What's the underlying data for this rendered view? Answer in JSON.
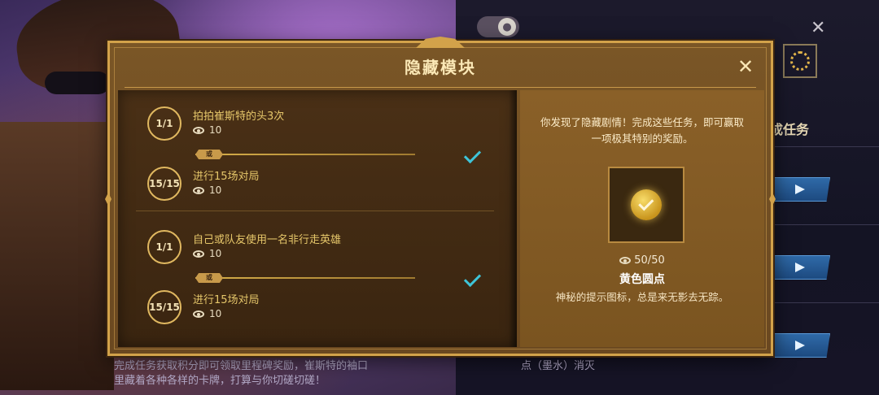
{
  "background": {
    "right_tab_label": "成任务",
    "left_note": "完成任务获取积分即可领取里程碑奖励，崔斯特的袖口里藏着各种各样的卡牌，打算与你切磋切磋！",
    "right_note": "点（墨水）消灭"
  },
  "modal": {
    "title": "隐藏模块",
    "close_icon": "close-icon",
    "groups": [
      {
        "tasks": [
          {
            "progress": "1/1",
            "name": "拍拍崔斯特的头3次",
            "views": "10"
          },
          {
            "progress": "15/15",
            "name": "进行15场对局",
            "views": "10"
          }
        ],
        "connector_label": "或",
        "completed": true
      },
      {
        "tasks": [
          {
            "progress": "1/1",
            "name": "自己或队友使用一名非行走英雄",
            "views": "10"
          },
          {
            "progress": "15/15",
            "name": "进行15场对局",
            "views": "10"
          }
        ],
        "connector_label": "或",
        "completed": true
      }
    ],
    "reward": {
      "description": "你发现了隐藏剧情！完成这些任务，即可赢取一项极其特别的奖励。",
      "count": "50/50",
      "name": "黄色圆点",
      "subtitle": "神秘的提示图标，总是来无影去无踪。"
    }
  },
  "colors": {
    "accent_gold": "#d2a24a",
    "check_cyan": "#3ec4d8",
    "task_text": "#e6c76a"
  }
}
